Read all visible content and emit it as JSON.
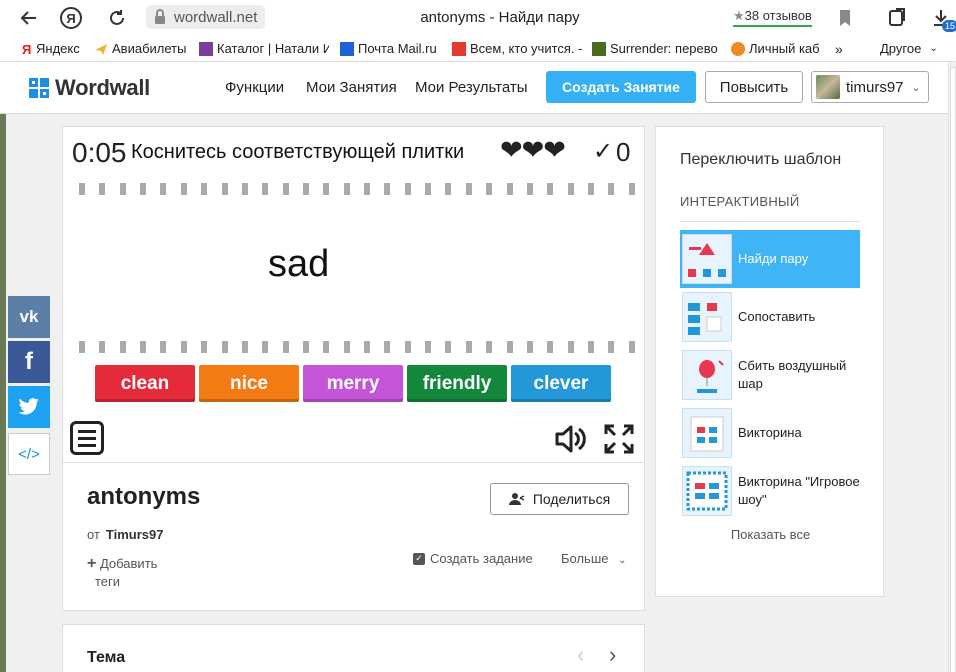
{
  "browser": {
    "url": "wordwall.net",
    "tab_title": "antonyms - Найди пару",
    "reviews": "38 отзывов",
    "downloads_badge": "15"
  },
  "bookmarks": [
    {
      "label": "Яндекс",
      "color": "#e22222"
    },
    {
      "label": "Авиабилеты",
      "color": "#f2b233"
    },
    {
      "label": "Каталог | Натали И",
      "color": "#7b3ea0"
    },
    {
      "label": "Почта Mail.ru",
      "color": "#1b62d6"
    },
    {
      "label": "Всем, кто учится. -",
      "color": "#e53a2f"
    },
    {
      "label": "Surrender: перево",
      "color": "#4a6a1f"
    },
    {
      "label": "Личный каб",
      "color": "#f08a24"
    }
  ],
  "bookmarks_more": "Другое",
  "header": {
    "logo": "Wordwall",
    "nav": [
      "Функции",
      "Мои Занятия",
      "Мои Результаты"
    ],
    "create_button": "Создать Занятие",
    "upgrade_button": "Повысить",
    "username": "timurs97"
  },
  "game": {
    "timer": "0:05",
    "instruction": "Коснитесь соответствующей плитки",
    "hearts": "❤❤❤",
    "score": "0",
    "word": "sad",
    "tiles": [
      {
        "label": "clean",
        "color": "#e52a3c"
      },
      {
        "label": "nice",
        "color": "#f47b13"
      },
      {
        "label": "merry",
        "color": "#c455d8"
      },
      {
        "label": "friendly",
        "color": "#13873c"
      },
      {
        "label": "clever",
        "color": "#2398d8"
      }
    ]
  },
  "activity": {
    "title": "antonyms",
    "share_button": "Поделиться",
    "author_prefix": "от",
    "author": "Timurs97",
    "add_tags": "Добавить теги",
    "create_task": "Создать задание",
    "more": "Больше"
  },
  "theme_section": {
    "title": "Тема"
  },
  "sidebar": {
    "title": "Переключить шаблон",
    "section": "ИНТЕРАКТИВНЫЙ",
    "templates": [
      {
        "label": "Найди пару",
        "active": true
      },
      {
        "label": "Сопоставить",
        "active": false
      },
      {
        "label": "Сбить воздушный шар",
        "active": false
      },
      {
        "label": "Викторина",
        "active": false
      },
      {
        "label": "Викторина \"Игровое шоу\"",
        "active": false
      }
    ],
    "show_all": "Показать все"
  },
  "social": [
    {
      "name": "vk",
      "glyph": "vk",
      "color": "#5b7fa6"
    },
    {
      "name": "facebook",
      "glyph": "f",
      "color": "#3b5998"
    },
    {
      "name": "twitter",
      "glyph": "t",
      "color": "#1da1f2"
    },
    {
      "name": "embed",
      "glyph": "</>",
      "color": "#ffffff"
    }
  ]
}
